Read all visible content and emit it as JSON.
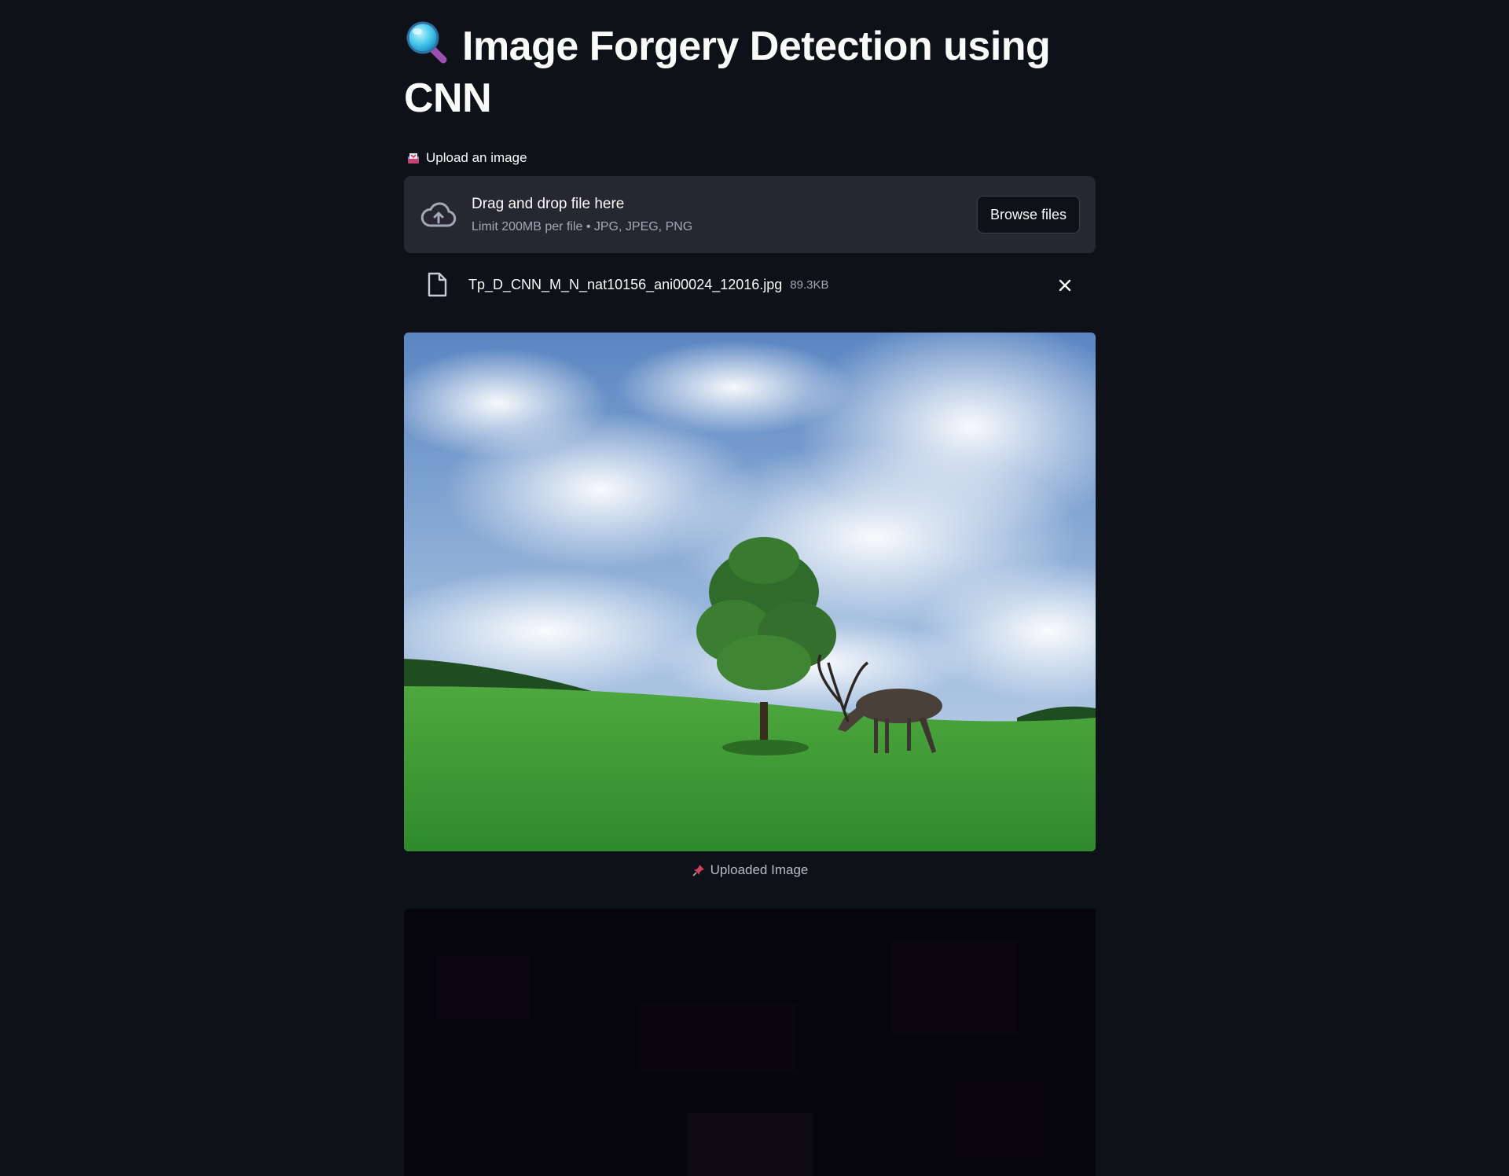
{
  "app": {
    "title": "Image Forgery Detection using CNN",
    "title_icon": "magnifier-icon"
  },
  "uploader": {
    "label": "Upload an image",
    "label_icon": "inbox-tray-icon",
    "drop_title": "Drag and drop file here",
    "drop_subtitle": "Limit 200MB per file • JPG, JPEG, PNG",
    "browse_label": "Browse files"
  },
  "uploaded_file": {
    "name": "Tp_D_CNN_M_N_nat10156_ani00024_12016.jpg",
    "size": "89.3KB"
  },
  "image": {
    "caption": "Uploaded Image",
    "caption_icon": "pushpin-icon"
  },
  "colors": {
    "background": "#0e1117",
    "dropzone": "#262730",
    "text": "#fafafa",
    "muted": "#a3a8b8"
  }
}
